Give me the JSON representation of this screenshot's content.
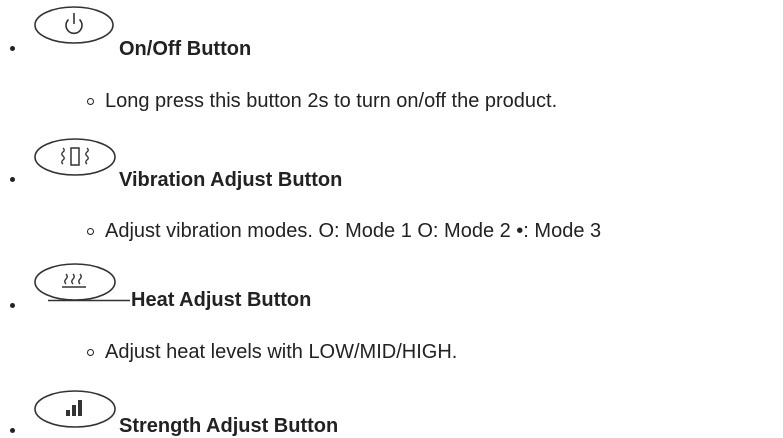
{
  "items": [
    {
      "icon": "power-icon",
      "title": "On/Off Button",
      "description": "Long press this button 2s to turn on/off the product."
    },
    {
      "icon": "vibration-icon",
      "title": "Vibration Adjust Button",
      "description": "Adjust vibration modes. O: Mode 1 O: Mode 2 •: Mode 3"
    },
    {
      "icon": "heat-icon",
      "title": "Heat Adjust Button",
      "description": "Adjust heat levels with LOW/MID/HIGH."
    },
    {
      "icon": "signal-bars-icon",
      "title": "Strength Adjust Button"
    }
  ]
}
